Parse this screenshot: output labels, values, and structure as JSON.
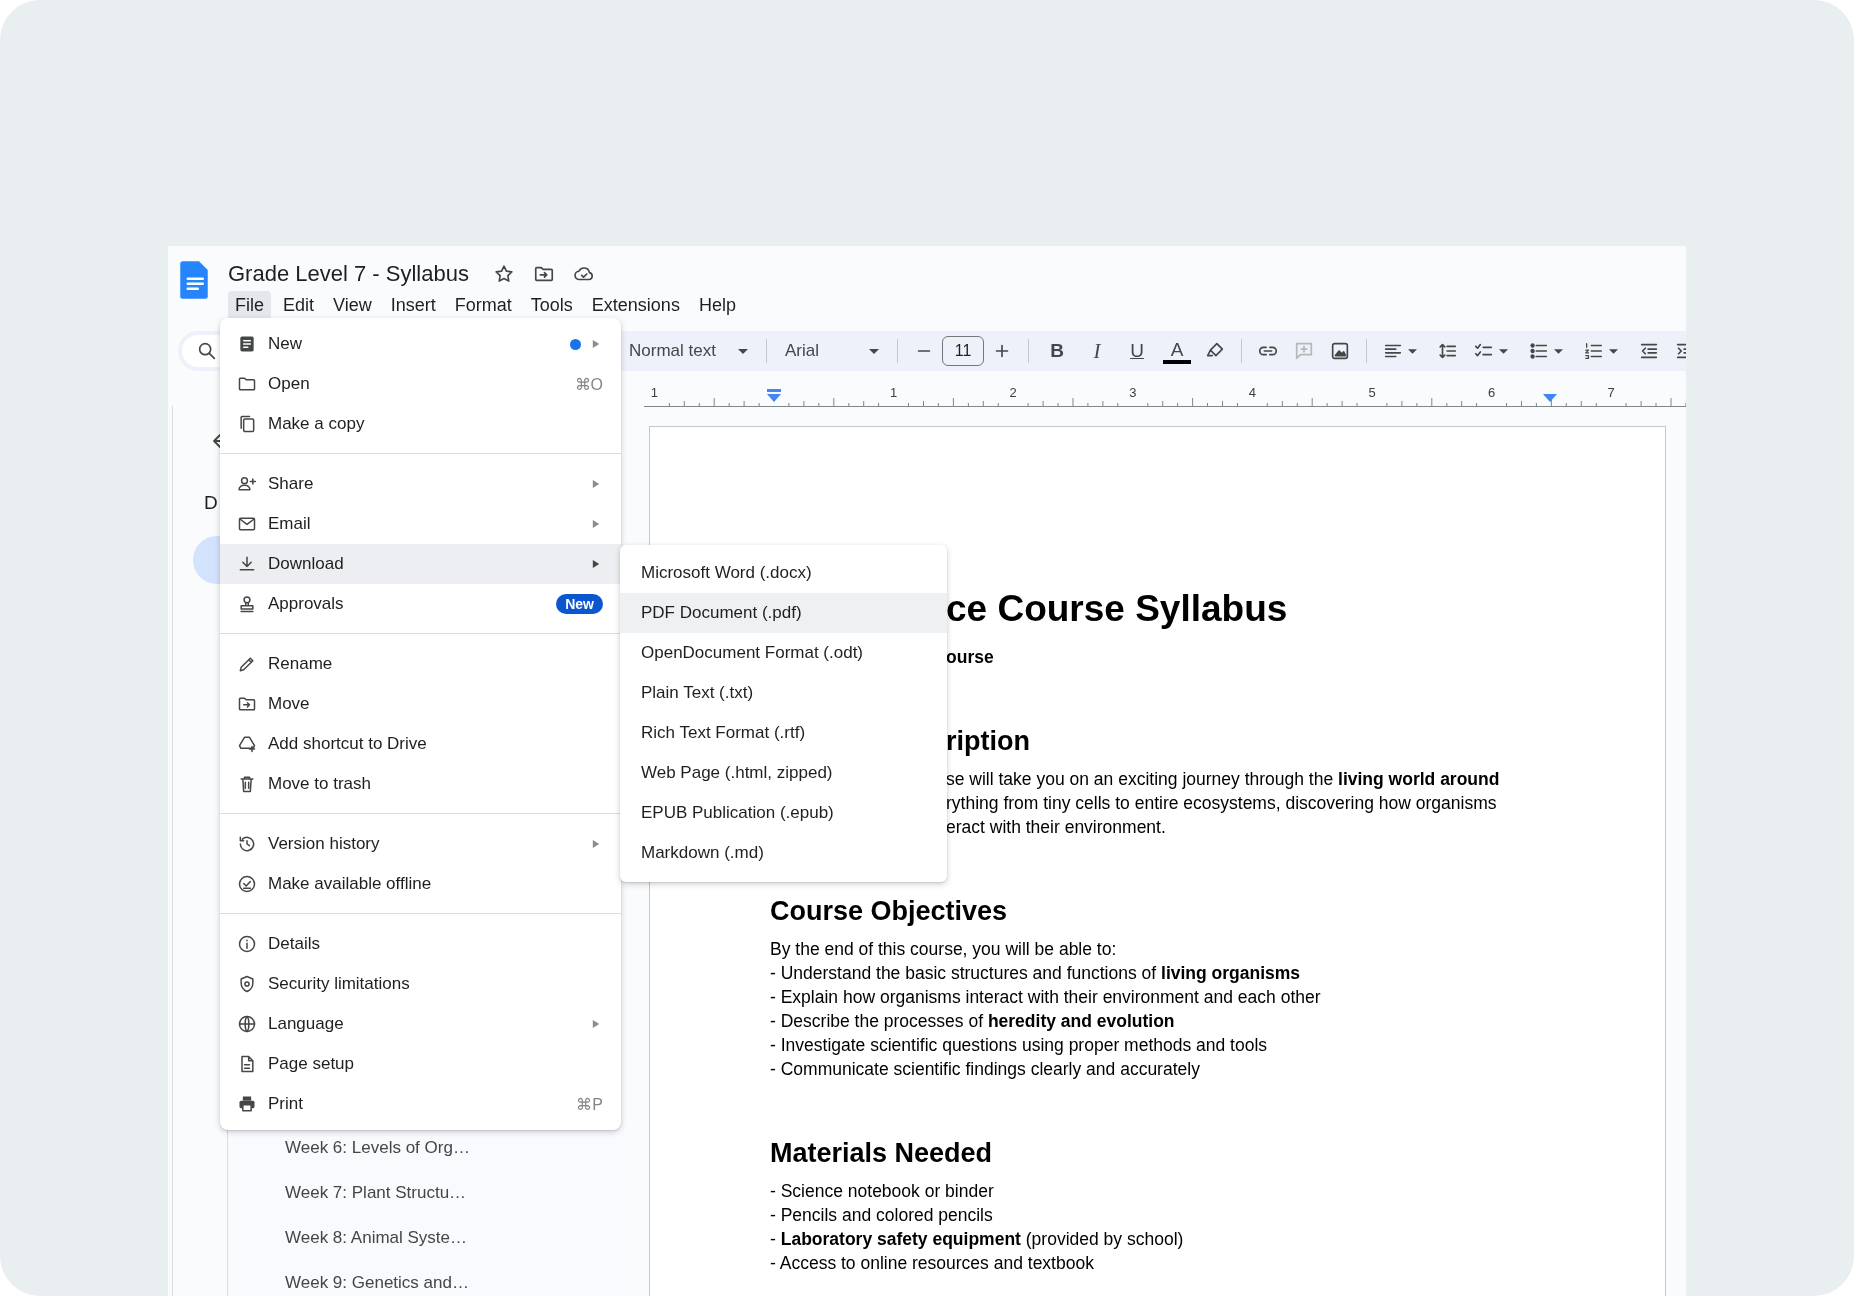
{
  "document_title": "Grade Level 7 - Syllabus",
  "menu_bar": [
    {
      "label": "File",
      "selected": true
    },
    {
      "label": "Edit",
      "selected": false
    },
    {
      "label": "View",
      "selected": false
    },
    {
      "label": "Insert",
      "selected": false
    },
    {
      "label": "Format",
      "selected": false
    },
    {
      "label": "Tools",
      "selected": false
    },
    {
      "label": "Extensions",
      "selected": false
    },
    {
      "label": "Help",
      "selected": false
    }
  ],
  "toolbar": {
    "style": "Normal text",
    "font": "Arial",
    "font_size": "11",
    "format_buttons": [
      {
        "kind": "bold",
        "label": "B"
      },
      {
        "kind": "italic",
        "label": "I"
      },
      {
        "kind": "underline",
        "label": "U"
      },
      {
        "kind": "text-color",
        "label": "A"
      }
    ]
  },
  "ruler": {
    "labels": [
      "1",
      "1",
      "2",
      "3",
      "4",
      "5",
      "6",
      "7"
    ]
  },
  "sidebar": {
    "heading": "D",
    "items": [
      {
        "label": "Week 6: Levels of Org…"
      },
      {
        "label": "Week 7: Plant Structu…"
      },
      {
        "label": "Week 8: Animal Syste…"
      },
      {
        "label": "Week 9: Genetics and…"
      }
    ]
  },
  "file_menu": {
    "groups": [
      [
        {
          "label": "New",
          "dot": true,
          "submenu": true,
          "selected": false
        },
        {
          "label": "Open",
          "shortcut": "⌘O",
          "dot": false,
          "submenu": false,
          "selected": false
        },
        {
          "label": "Make a copy",
          "dot": false,
          "submenu": false,
          "selected": false
        }
      ],
      [
        {
          "label": "Share",
          "dot": false,
          "submenu": true,
          "selected": false
        },
        {
          "label": "Email",
          "dot": false,
          "submenu": true,
          "selected": false
        },
        {
          "label": "Download",
          "dot": false,
          "submenu": true,
          "selected": true
        },
        {
          "label": "Approvals",
          "badge": "New",
          "dot": false,
          "submenu": false,
          "selected": false
        }
      ],
      [
        {
          "label": "Rename",
          "dot": false,
          "submenu": false,
          "selected": false
        },
        {
          "label": "Move",
          "dot": false,
          "submenu": false,
          "selected": false
        },
        {
          "label": "Add shortcut to Drive",
          "dot": false,
          "submenu": false,
          "selected": false
        },
        {
          "label": "Move to trash",
          "dot": false,
          "submenu": false,
          "selected": false
        }
      ],
      [
        {
          "label": "Version history",
          "dot": false,
          "submenu": true,
          "selected": false
        },
        {
          "label": "Make available offline",
          "dot": false,
          "submenu": false,
          "selected": false
        }
      ],
      [
        {
          "label": "Details",
          "dot": false,
          "submenu": false,
          "selected": false
        },
        {
          "label": "Security limitations",
          "dot": false,
          "submenu": false,
          "selected": false
        },
        {
          "label": "Language",
          "dot": false,
          "submenu": true,
          "selected": false
        },
        {
          "label": "Page setup",
          "dot": false,
          "submenu": false,
          "selected": false
        },
        {
          "label": "Print",
          "shortcut": "⌘P",
          "dot": false,
          "submenu": false,
          "selected": false
        }
      ]
    ]
  },
  "download_submenu": {
    "items": [
      {
        "label": "Microsoft Word (.docx)",
        "selected": false
      },
      {
        "label": "PDF Document (.pdf)",
        "selected": true
      },
      {
        "label": "OpenDocument Format (.odt)",
        "selected": false
      },
      {
        "label": "Plain Text (.txt)",
        "selected": false
      },
      {
        "label": "Rich Text Format (.rtf)",
        "selected": false
      },
      {
        "label": "Web Page (.html, zipped)",
        "selected": false
      },
      {
        "label": "EPUB Publication (.epub)",
        "selected": false
      },
      {
        "label": "Markdown (.md)",
        "selected": false
      }
    ]
  },
  "document": {
    "partly_covered_blocks": [
      {
        "kind": "title",
        "text": "ce Course Syllabus"
      },
      {
        "kind": "subtitle",
        "text": "ourse"
      },
      {
        "kind": "heading",
        "text": "ription"
      },
      {
        "kind": "line",
        "text": "se will take you on an exciting journey through the **living world around**"
      },
      {
        "kind": "line",
        "text": "rything from tiny cells to entire ecosystems, discovering how organisms"
      },
      {
        "kind": "line",
        "text": "eract with their environment."
      }
    ],
    "blocks": [
      {
        "kind": "heading",
        "text": "Course Objectives"
      },
      {
        "kind": "line",
        "text": "By the end of this course, you will be able to:"
      },
      {
        "kind": "line",
        "text": "- Understand the basic structures and functions of **living organisms**"
      },
      {
        "kind": "line",
        "text": "- Explain how organisms interact with their environment and each other"
      },
      {
        "kind": "line",
        "text": "- Describe the processes of **heredity and evolution**"
      },
      {
        "kind": "line",
        "text": "- Investigate scientific questions using proper methods and tools"
      },
      {
        "kind": "line",
        "text": "- Communicate scientific findings clearly and accurately"
      },
      {
        "kind": "heading",
        "text": "Materials Needed"
      },
      {
        "kind": "line",
        "text": "- Science notebook or binder"
      },
      {
        "kind": "line",
        "text": "- Pencils and colored pencils"
      },
      {
        "kind": "line",
        "text": "- **Laboratory safety equipment** (provided by school)"
      },
      {
        "kind": "line",
        "text": "- Access to online resources and textbook"
      }
    ]
  }
}
